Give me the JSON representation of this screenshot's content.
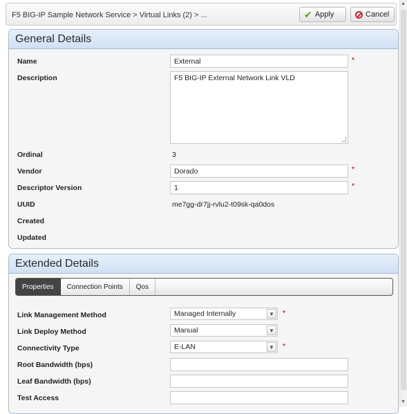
{
  "toolbar": {
    "breadcrumb": "F5 BIG-IP Sample Network Service > Virtual Links (2) > ...",
    "apply_label": "Apply",
    "cancel_label": "Cancel"
  },
  "general": {
    "title": "General Details",
    "name_label": "Name",
    "name_value": "External",
    "description_label": "Description",
    "description_value": "F5 BIG-IP External Network Link VLD",
    "ordinal_label": "Ordinal",
    "ordinal_value": "3",
    "vendor_label": "Vendor",
    "vendor_value": "Dorado",
    "descriptor_version_label": "Descriptor Version",
    "descriptor_version_value": "1",
    "uuid_label": "UUID",
    "uuid_value": "me7gg-dr7jj-rvlu2-t09sk-qa0dos",
    "created_label": "Created",
    "updated_label": "Updated"
  },
  "extended": {
    "title": "Extended Details",
    "tabs": [
      {
        "label": "Properties"
      },
      {
        "label": "Connection Points"
      },
      {
        "label": "Qos"
      }
    ],
    "link_management_label": "Link Management Method",
    "link_management_value": "Managed Internally",
    "link_deploy_label": "Link Deploy Method",
    "link_deploy_value": "Manual",
    "connectivity_label": "Connectivity Type",
    "connectivity_value": "E-LAN",
    "root_bw_label": "Root Bandwidth (bps)",
    "leaf_bw_label": "Leaf Bandwidth (bps)",
    "test_access_label": "Test Access"
  },
  "icons": {
    "required": "*",
    "dropdown": "▼",
    "apply": "✔"
  }
}
